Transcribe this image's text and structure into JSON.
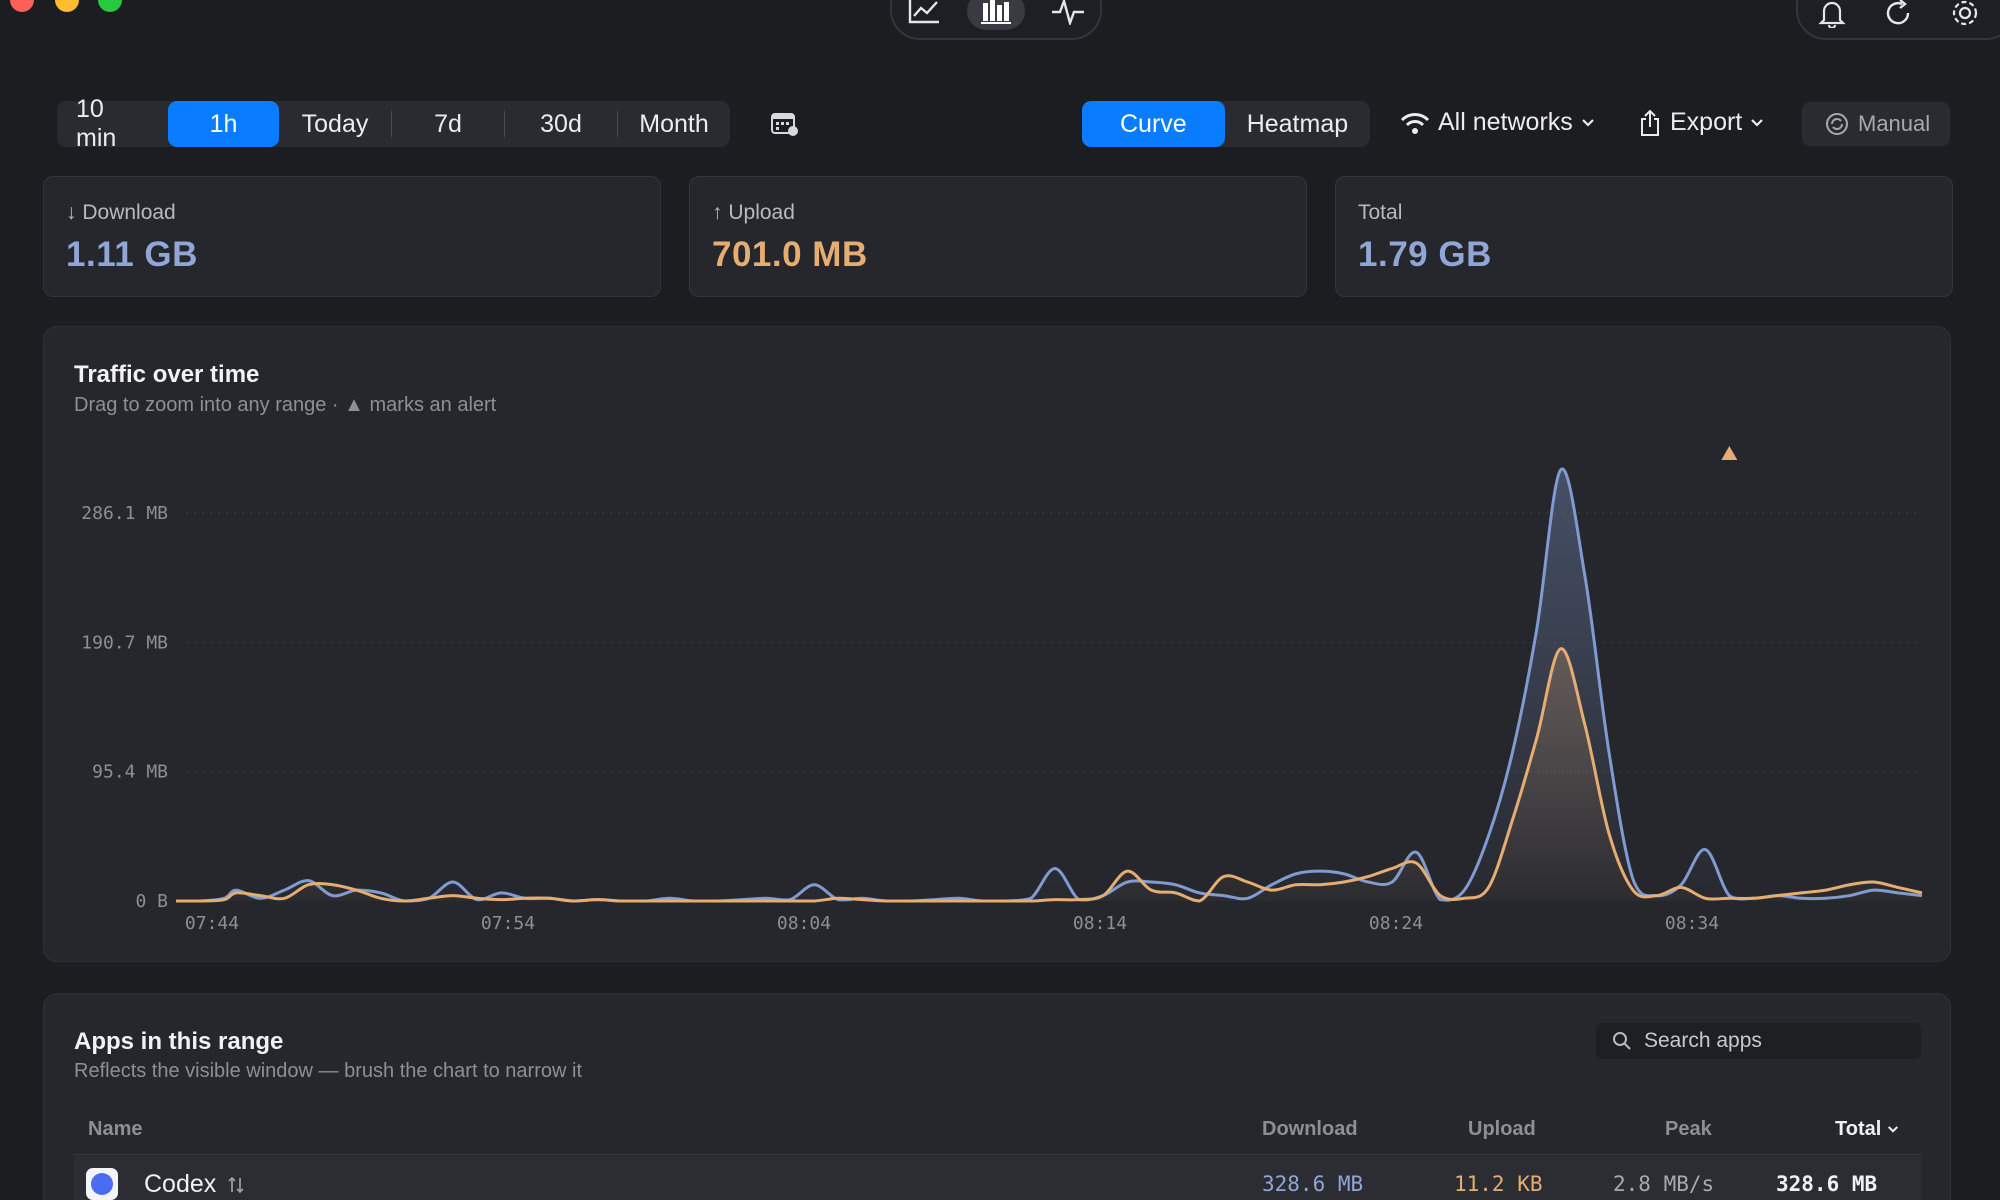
{
  "window": {
    "controls": [
      "close",
      "minimize",
      "zoom"
    ]
  },
  "toolbar": {
    "view_icons": [
      "chart-line-icon",
      "bar-chart-icon",
      "activity-icon"
    ],
    "right_icons": [
      "bell-icon",
      "refresh-icon",
      "gear-icon"
    ]
  },
  "ranges": [
    {
      "label": "10 min",
      "active": false
    },
    {
      "label": "1h",
      "active": true
    },
    {
      "label": "Today",
      "active": false
    },
    {
      "label": "7d",
      "active": false
    },
    {
      "label": "30d",
      "active": false
    },
    {
      "label": "Month",
      "active": false
    }
  ],
  "view_modes": {
    "curve": "Curve",
    "heatmap": "Heatmap",
    "active": "Curve"
  },
  "network_filter": "All networks",
  "export_label": "Export",
  "manual_label": "Manual",
  "stats": {
    "download": {
      "label": "Download",
      "value": "1.11 GB",
      "color": "#8fa6d6"
    },
    "upload": {
      "label": "Upload",
      "value": "701.0 MB",
      "color": "#e6ad72"
    },
    "total": {
      "label": "Total",
      "value": "1.79 GB",
      "color": "#8fa6d6"
    }
  },
  "traffic": {
    "title": "Traffic over time",
    "subtitle_pre": "Drag to zoom into any range ·",
    "subtitle_post": "marks an alert"
  },
  "chart_data": {
    "type": "line",
    "y_ticks": [
      "286.1 MB",
      "190.7 MB",
      "95.4 MB",
      "0 B"
    ],
    "x_ticks": [
      "07:44",
      "07:54",
      "08:04",
      "08:14",
      "08:24",
      "08:34"
    ],
    "ylim_mb": [
      0,
      286.1
    ],
    "series": [
      {
        "color": "#7f9bd1",
        "points": [
          [
            0,
            0
          ],
          [
            2,
            0
          ],
          [
            4,
            2
          ],
          [
            5,
            8
          ],
          [
            7,
            2
          ],
          [
            9,
            8
          ],
          [
            11,
            15
          ],
          [
            13,
            4
          ],
          [
            15,
            8
          ],
          [
            17,
            6
          ],
          [
            19,
            0
          ],
          [
            21,
            2
          ],
          [
            23,
            14
          ],
          [
            25,
            1
          ],
          [
            27,
            6
          ],
          [
            29,
            2
          ],
          [
            31,
            2
          ],
          [
            33,
            0
          ],
          [
            35,
            1
          ],
          [
            37,
            0
          ],
          [
            39,
            0
          ],
          [
            41,
            2
          ],
          [
            43,
            0
          ],
          [
            45,
            0
          ],
          [
            47,
            1
          ],
          [
            49,
            2
          ],
          [
            51,
            1
          ],
          [
            53,
            12
          ],
          [
            55,
            1
          ],
          [
            57,
            2
          ],
          [
            59,
            0
          ],
          [
            61,
            0
          ],
          [
            63,
            1
          ],
          [
            65,
            2
          ],
          [
            67,
            0
          ],
          [
            69,
            0
          ],
          [
            71,
            2
          ],
          [
            73,
            24
          ],
          [
            75,
            1
          ],
          [
            77,
            4
          ],
          [
            79,
            14
          ],
          [
            81,
            14
          ],
          [
            83,
            12
          ],
          [
            85,
            6
          ],
          [
            87,
            4
          ],
          [
            89,
            2
          ],
          [
            91,
            12
          ],
          [
            93,
            20
          ],
          [
            95,
            22
          ],
          [
            97,
            20
          ],
          [
            99,
            14
          ],
          [
            101,
            14
          ],
          [
            103,
            36
          ],
          [
            105,
            1
          ],
          [
            107,
            8
          ],
          [
            109,
            48
          ],
          [
            111,
            110
          ],
          [
            113,
            200
          ],
          [
            115,
            318
          ],
          [
            117,
            240
          ],
          [
            119,
            110
          ],
          [
            121,
            16
          ],
          [
            123,
            4
          ],
          [
            125,
            12
          ],
          [
            127,
            38
          ],
          [
            129,
            4
          ],
          [
            131,
            2
          ],
          [
            133,
            4
          ],
          [
            135,
            2
          ],
          [
            137,
            2
          ],
          [
            139,
            4
          ],
          [
            141,
            8
          ],
          [
            143,
            6
          ],
          [
            145,
            4
          ]
        ]
      },
      {
        "color": "#e6ad72",
        "points": [
          [
            0,
            0
          ],
          [
            2,
            0
          ],
          [
            4,
            1
          ],
          [
            5,
            6
          ],
          [
            7,
            4
          ],
          [
            9,
            2
          ],
          [
            11,
            12
          ],
          [
            13,
            12
          ],
          [
            15,
            8
          ],
          [
            17,
            2
          ],
          [
            19,
            0
          ],
          [
            21,
            2
          ],
          [
            23,
            4
          ],
          [
            25,
            2
          ],
          [
            27,
            1
          ],
          [
            29,
            2
          ],
          [
            31,
            2
          ],
          [
            33,
            0
          ],
          [
            35,
            1
          ],
          [
            37,
            0
          ],
          [
            39,
            0
          ],
          [
            41,
            0
          ],
          [
            43,
            0
          ],
          [
            45,
            0
          ],
          [
            47,
            0
          ],
          [
            49,
            0
          ],
          [
            51,
            0
          ],
          [
            53,
            0
          ],
          [
            55,
            2
          ],
          [
            57,
            1
          ],
          [
            59,
            0
          ],
          [
            61,
            0
          ],
          [
            63,
            0
          ],
          [
            65,
            0
          ],
          [
            67,
            0
          ],
          [
            69,
            0
          ],
          [
            71,
            0
          ],
          [
            73,
            1
          ],
          [
            75,
            1
          ],
          [
            77,
            4
          ],
          [
            79,
            22
          ],
          [
            81,
            8
          ],
          [
            83,
            6
          ],
          [
            85,
            0
          ],
          [
            87,
            18
          ],
          [
            89,
            14
          ],
          [
            91,
            8
          ],
          [
            93,
            12
          ],
          [
            95,
            12
          ],
          [
            97,
            14
          ],
          [
            99,
            18
          ],
          [
            101,
            24
          ],
          [
            103,
            28
          ],
          [
            105,
            4
          ],
          [
            107,
            2
          ],
          [
            109,
            10
          ],
          [
            111,
            60
          ],
          [
            113,
            120
          ],
          [
            115,
            186
          ],
          [
            117,
            130
          ],
          [
            119,
            50
          ],
          [
            121,
            8
          ],
          [
            123,
            4
          ],
          [
            125,
            10
          ],
          [
            127,
            2
          ],
          [
            129,
            2
          ],
          [
            131,
            2
          ],
          [
            133,
            4
          ],
          [
            135,
            6
          ],
          [
            137,
            8
          ],
          [
            139,
            12
          ],
          [
            141,
            14
          ],
          [
            143,
            10
          ],
          [
            145,
            6
          ]
        ]
      }
    ],
    "x_range": [
      0,
      145
    ],
    "alert_marker": {
      "x": 129,
      "y": 310
    },
    "grid": true
  },
  "apps": {
    "title": "Apps in this range",
    "subtitle": "Reflects the visible window — brush the chart to narrow it",
    "search_placeholder": "Search apps",
    "columns": {
      "name": "Name",
      "download": "Download",
      "upload": "Upload",
      "peak": "Peak",
      "total": "Total"
    },
    "rows": [
      {
        "name": "Codex",
        "download": "328.6 MB",
        "upload": "11.2 KB",
        "peak": "2.8 MB/s",
        "total": "328.6 MB"
      }
    ]
  }
}
